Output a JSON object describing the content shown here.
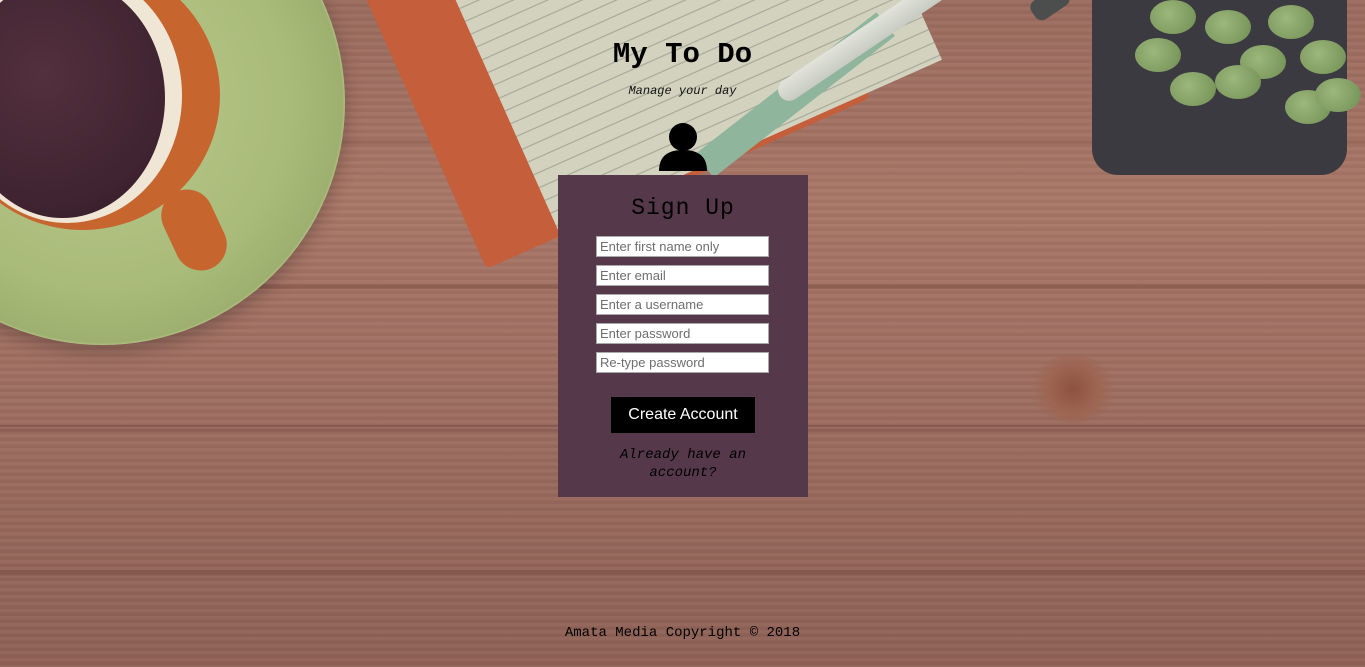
{
  "header": {
    "title": "My To Do",
    "subtitle": "Manage your day"
  },
  "icons": {
    "user": "user-icon"
  },
  "signup_form": {
    "heading": "Sign Up",
    "fields": [
      {
        "name": "first-name",
        "placeholder": "Enter first name only",
        "value": ""
      },
      {
        "name": "email",
        "placeholder": "Enter email",
        "value": ""
      },
      {
        "name": "username",
        "placeholder": "Enter a username",
        "value": ""
      },
      {
        "name": "password",
        "placeholder": "Enter password",
        "value": ""
      },
      {
        "name": "retype-password",
        "placeholder": "Re-type password",
        "value": ""
      }
    ],
    "submit_label": "Create Account",
    "login_link": "Already have an account?"
  },
  "footer": {
    "copyright": "Amata Media Copyright © 2018"
  },
  "colors": {
    "card_background": "#553849",
    "button_background": "#000000",
    "button_text": "#ffffff"
  }
}
